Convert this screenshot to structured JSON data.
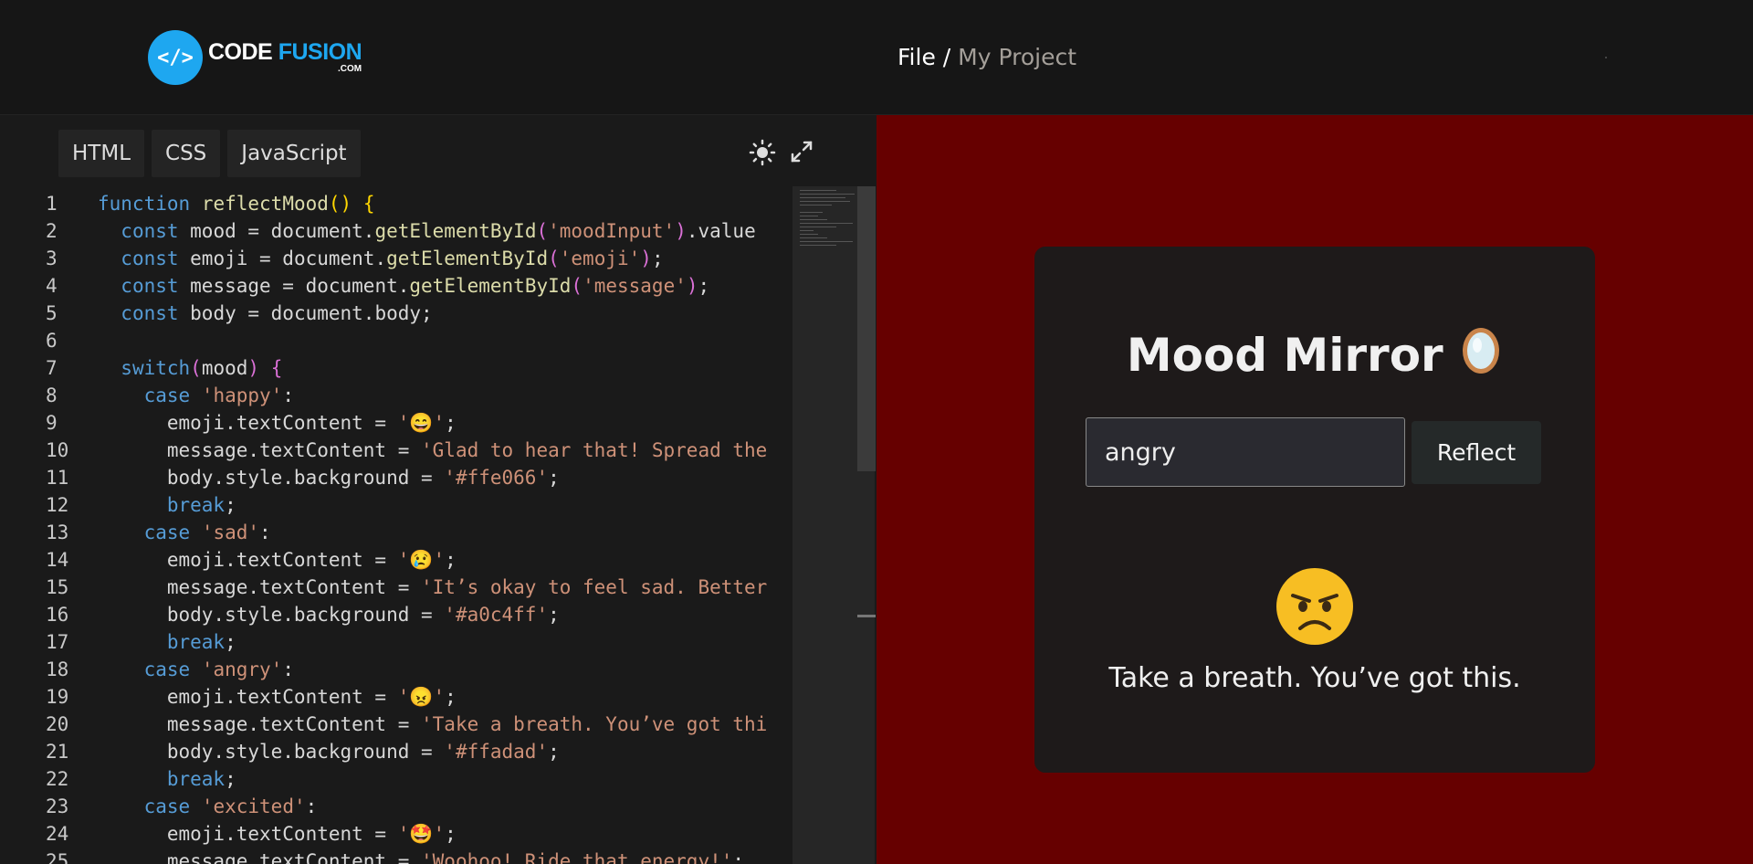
{
  "header": {
    "logo_symbol": "</>",
    "logo_code": "CODE ",
    "logo_fusion": "FUSION",
    "logo_com": ".COM",
    "breadcrumb_file": "File",
    "breadcrumb_sep": " / ",
    "breadcrumb_project": "My Project"
  },
  "editor": {
    "tabs": [
      "HTML",
      "CSS",
      "JavaScript"
    ],
    "theme_icon": "sun-icon",
    "expand_icon": "expand-icon"
  },
  "preview": {
    "title": "Mood Mirror",
    "title_emoji": "🪞",
    "input_value": "angry",
    "button_label": "Reflect",
    "emoji": "😠",
    "message": "Take a breath. You’ve got this.",
    "background": "#660000"
  }
}
